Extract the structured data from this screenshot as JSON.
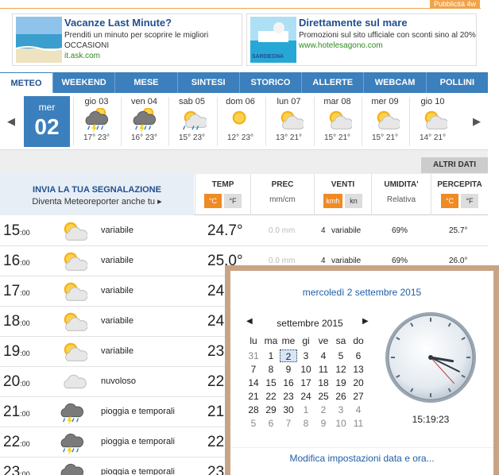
{
  "ads": {
    "badge": "Pubblicità 4w",
    "items": [
      {
        "title": "Vacanze Last Minute?",
        "line1": "Prenditi un minuto per scoprire le migliori",
        "line2": "OCCASIONI",
        "url": "it.ask.com"
      },
      {
        "title": "Direttamente sul mare",
        "line1": "Promozioni sul sito ufficiale con sconti sino al 20%",
        "line2": "",
        "url": "www.hotelesagono.com",
        "img_caption": "SARDEGNA"
      }
    ]
  },
  "tabs": [
    "METEO",
    "WEEKEND",
    "MESE",
    "SINTESI",
    "STORICO",
    "ALLERTE",
    "WEBCAM",
    "POLLINI"
  ],
  "days": {
    "selected": {
      "name": "mer",
      "num": "02"
    },
    "items": [
      {
        "name": "gio 03",
        "temp": "17° 23°",
        "icon": "storm-sun-icon"
      },
      {
        "name": "ven 04",
        "temp": "16° 23°",
        "icon": "storm-sun-icon"
      },
      {
        "name": "sab 05",
        "temp": "15° 23°",
        "icon": "rain-sun-icon"
      },
      {
        "name": "dom 06",
        "temp": "12° 23°",
        "icon": "sun-icon"
      },
      {
        "name": "lun 07",
        "temp": "13° 21°",
        "icon": "partly-cloudy-icon"
      },
      {
        "name": "mar 08",
        "temp": "15° 21°",
        "icon": "partly-cloudy-icon"
      },
      {
        "name": "mer 09",
        "temp": "15° 21°",
        "icon": "partly-cloudy-icon"
      },
      {
        "name": "gio 10",
        "temp": "14° 21°",
        "icon": "partly-cloudy-icon"
      }
    ]
  },
  "altri_dati": "ALTRI DATI",
  "report": {
    "title": "INVIA LA TUA SEGNALAZIONE",
    "subtitle": "Diventa Meteoreporter anche tu"
  },
  "columns": {
    "temp": {
      "label": "TEMP",
      "units": [
        "°C",
        "°F"
      ]
    },
    "prec": {
      "label": "PREC",
      "unit": "mm/cm"
    },
    "venti": {
      "label": "VENTI",
      "units": [
        "kmh",
        "kn"
      ]
    },
    "umidita": {
      "label": "UMIDITA'",
      "sub": "Relativa"
    },
    "percepita": {
      "label": "PERCEPITA",
      "units": [
        "°C",
        "°F"
      ]
    }
  },
  "hours": [
    {
      "h": "15",
      "m": ":00",
      "icon": "partly-cloudy-icon",
      "desc": "variabile",
      "temp": "24.7°",
      "prec": "0.0 mm",
      "wind_speed": "4",
      "wind_dir": "variabile",
      "hum": "69%",
      "feel": "25.7°"
    },
    {
      "h": "16",
      "m": ":00",
      "icon": "partly-cloudy-icon",
      "desc": "variabile",
      "temp": "25.0°",
      "prec": "0.0 mm",
      "wind_speed": "4",
      "wind_dir": "variabile",
      "hum": "69%",
      "feel": "26.0°"
    },
    {
      "h": "17",
      "m": ":00",
      "icon": "partly-cloudy-icon",
      "desc": "variabile",
      "temp": "24",
      "prec": "",
      "wind_speed": "",
      "wind_dir": "",
      "hum": "",
      "feel": ""
    },
    {
      "h": "18",
      "m": ":00",
      "icon": "partly-cloudy-icon",
      "desc": "variabile",
      "temp": "24",
      "prec": "",
      "wind_speed": "",
      "wind_dir": "",
      "hum": "",
      "feel": ""
    },
    {
      "h": "19",
      "m": ":00",
      "icon": "partly-cloudy-icon",
      "desc": "variabile",
      "temp": "23",
      "prec": "",
      "wind_speed": "",
      "wind_dir": "",
      "hum": "",
      "feel": ""
    },
    {
      "h": "20",
      "m": ":00",
      "icon": "cloud-icon",
      "desc": "nuvoloso",
      "temp": "22",
      "prec": "",
      "wind_speed": "",
      "wind_dir": "",
      "hum": "",
      "feel": ""
    },
    {
      "h": "21",
      "m": ":00",
      "icon": "storm-icon",
      "desc": "pioggia e temporali",
      "temp": "21",
      "prec": "",
      "wind_speed": "",
      "wind_dir": "",
      "hum": "",
      "feel": ""
    },
    {
      "h": "22",
      "m": ":00",
      "icon": "storm-icon",
      "desc": "pioggia e temporali",
      "temp": "22",
      "prec": "",
      "wind_speed": "",
      "wind_dir": "",
      "hum": "",
      "feel": ""
    },
    {
      "h": "23",
      "m": ":00",
      "icon": "storm-icon",
      "desc": "pioggia e temporali",
      "temp": "23",
      "prec": "",
      "wind_speed": "",
      "wind_dir": "",
      "hum": "",
      "feel": ""
    }
  ],
  "popup": {
    "date": "mercoledì 2 settembre 2015",
    "month": "settembre 2015",
    "weekdays": [
      "lu",
      "ma",
      "me",
      "gi",
      "ve",
      "sa",
      "do"
    ],
    "weeks": [
      [
        "31",
        "1",
        "2",
        "3",
        "4",
        "5",
        "6"
      ],
      [
        "7",
        "8",
        "9",
        "10",
        "11",
        "12",
        "13"
      ],
      [
        "14",
        "15",
        "16",
        "17",
        "18",
        "19",
        "20"
      ],
      [
        "21",
        "22",
        "23",
        "24",
        "25",
        "26",
        "27"
      ],
      [
        "28",
        "29",
        "30",
        "1",
        "2",
        "3",
        "4"
      ],
      [
        "5",
        "6",
        "7",
        "8",
        "9",
        "10",
        "11"
      ]
    ],
    "today": "2",
    "time": "15:19:23",
    "clock": {
      "hours": 15,
      "minutes": 19,
      "seconds": 23
    },
    "link": "Modifica impostazioni data e ora..."
  },
  "colors": {
    "accent": "#3b7fbd",
    "orange": "#f08a24"
  }
}
